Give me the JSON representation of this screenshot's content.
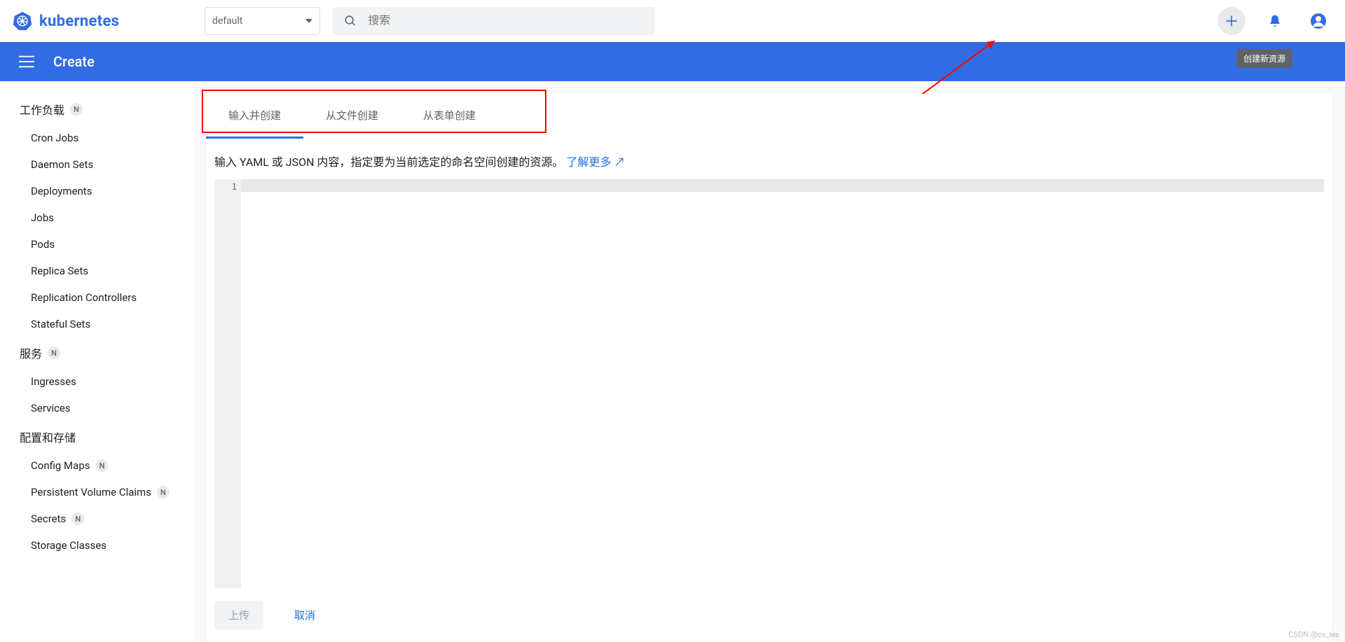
{
  "brand": "kubernetes",
  "namespace_selected": "default",
  "search_placeholder": "搜索",
  "subheader_title": "Create",
  "tooltip_create": "创建新资源",
  "sidebar": {
    "sections": [
      {
        "title": "工作负载",
        "badge": "N",
        "items": [
          {
            "label": "Cron Jobs"
          },
          {
            "label": "Daemon Sets"
          },
          {
            "label": "Deployments"
          },
          {
            "label": "Jobs"
          },
          {
            "label": "Pods"
          },
          {
            "label": "Replica Sets"
          },
          {
            "label": "Replication Controllers"
          },
          {
            "label": "Stateful Sets"
          }
        ]
      },
      {
        "title": "服务",
        "badge": "N",
        "items": [
          {
            "label": "Ingresses"
          },
          {
            "label": "Services"
          }
        ]
      },
      {
        "title": "配置和存储",
        "badge": "",
        "items": [
          {
            "label": "Config Maps",
            "badge": "N"
          },
          {
            "label": "Persistent Volume Claims",
            "badge": "N"
          },
          {
            "label": "Secrets",
            "badge": "N"
          },
          {
            "label": "Storage Classes"
          }
        ]
      }
    ]
  },
  "tabs": [
    {
      "label": "输入并创建",
      "active": true
    },
    {
      "label": "从文件创建",
      "active": false
    },
    {
      "label": "从表单创建",
      "active": false
    }
  ],
  "description": "输入 YAML 或 JSON 内容，指定要为当前选定的命名空间创建的资源。",
  "learn_more": "了解更多",
  "editor": {
    "line_number": "1",
    "content": ""
  },
  "buttons": {
    "upload": "上传",
    "cancel": "取消"
  },
  "watermark": "CSDN @os_lee",
  "colors": {
    "brand": "#326ce5",
    "link": "#1a73e8"
  }
}
